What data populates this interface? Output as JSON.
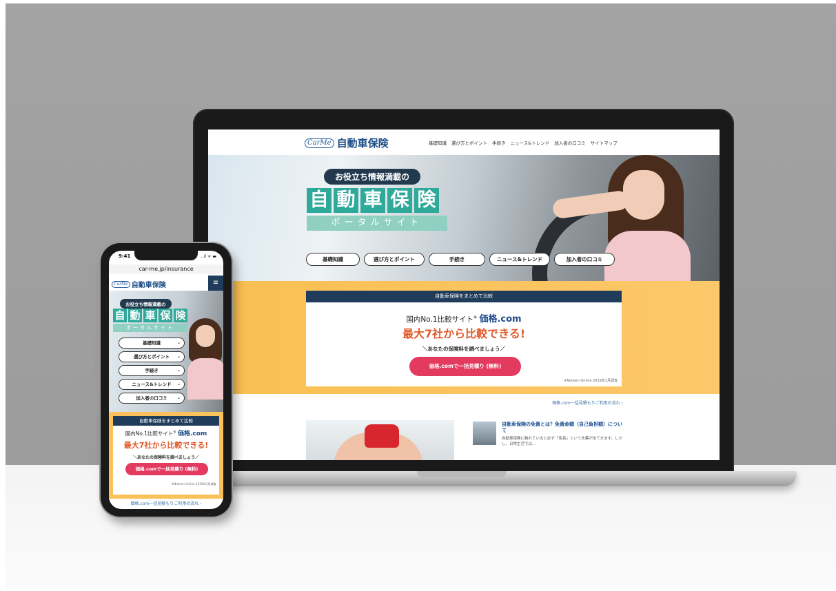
{
  "site": {
    "logo_mark": "CarMe",
    "logo_text": "自動車保険",
    "nav": [
      "基礎知識",
      "選び方とポイント",
      "手続き",
      "ニュース&トレンド",
      "加入者の口コミ",
      "サイトマップ"
    ]
  },
  "hero": {
    "tagline": "お役立ち情報満載の",
    "kanji": [
      "自",
      "動",
      "車",
      "保",
      "険"
    ],
    "subtitle": "ポータルサイト",
    "pills": [
      "基礎知識",
      "選び方とポイント",
      "手続き",
      "ニュース&トレンド",
      "加入者の口コミ"
    ]
  },
  "compare": {
    "header": "自動車保険をまとめて比較",
    "line1_prefix": "国内No.1比較サイト",
    "line1_mark": "※",
    "kakaku_logo": "価格.com",
    "line2": "最大7社から比較できる!",
    "line3": "＼あなたの保険料を調べましょう／",
    "button_desktop": "価格.comで一括見積り (無料)",
    "button_mobile": "価格.comで一括見積り (無料)",
    "note": "※Nielsen Online 2019年1月調査"
  },
  "flow_link": "価格.com一括見積もりご利用の流れ ›",
  "article": {
    "title": "自動車保険の免責とは？免責金額（自己負担額）について",
    "body": "自動車保険に触れていると必ず「免責」という言葉が出てきます。しかし、日常生活では…"
  },
  "phone": {
    "time": "9:41",
    "status": "..ıl ᯤ ▬",
    "url": "car-me.jp/insurance",
    "menu_icon": "≡",
    "buttons": [
      "基礎知識",
      "選び方とポイント",
      "手続き",
      "ニュース&トレンド",
      "加入者の口コミ"
    ],
    "chevron": "⌄",
    "link": "価格.com一括見積もりご利用の流れ ›"
  }
}
